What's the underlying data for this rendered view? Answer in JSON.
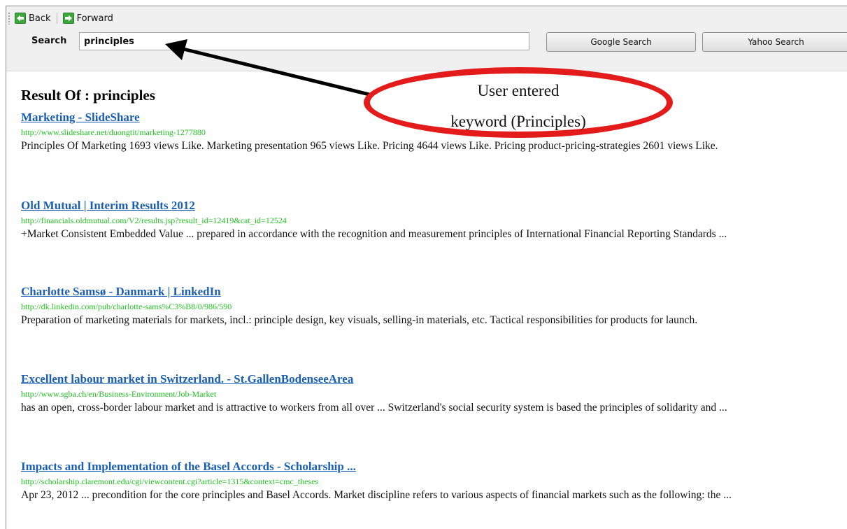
{
  "nav": {
    "back_label": "Back",
    "forward_label": "Forward"
  },
  "search": {
    "label": "Search",
    "value": "principles",
    "google_button": "Google Search",
    "yahoo_button": "Yahoo Search"
  },
  "results_heading": "Result Of : principles",
  "results": [
    {
      "title": "Marketing - SlideShare",
      "url": "http://www.slideshare.net/duongtit/marketing-1277880",
      "snippet": "Principles Of Marketing 1693 views Like. Marketing presentation 965 views Like. Pricing 4644 views Like. Pricing product-pricing-strategies 2601 views Like."
    },
    {
      "title": "Old Mutual | Interim Results 2012",
      "url": "http://financials.oldmutual.com/V2/results.jsp?result_id=12419&cat_id=12524",
      "snippet": "+Market Consistent Embedded Value ... prepared in accordance with the recognition and measurement principles of International Financial Reporting Standards ..."
    },
    {
      "title": "Charlotte Samsø - Danmark | LinkedIn",
      "url": "http://dk.linkedin.com/pub/charlotte-sams%C3%B8/0/986/590",
      "snippet": "Preparation of marketing materials for markets, incl.: principle design, key visuals, selling-in materials, etc. Tactical responsibilities for products for launch."
    },
    {
      "title": "Excellent labour market in Switzerland. - St.GallenBodenseeArea",
      "url": "http://www.sgba.ch/en/Business-Environment/Job-Market",
      "snippet": "has an open, cross-border labour market and is attractive to workers from all over ... Switzerland's social security system is based the principles of solidarity and ..."
    },
    {
      "title": "Impacts and Implementation of the Basel Accords - Scholarship ...",
      "url": "http://scholarship.claremont.edu/cgi/viewcontent.cgi?article=1315&context=cmc_theses",
      "snippet": "Apr 23, 2012 ... precondition for the core principles and Basel Accords. Market discipline refers to various aspects of financial markets such as the following: the ..."
    }
  ],
  "annotation": {
    "line1": "User entered",
    "line2": "keyword (Principles)",
    "color": "#e41b1b"
  },
  "colors": {
    "link": "#1a5fb4",
    "url": "#22c322",
    "nav_icon": "#3aa83a"
  }
}
